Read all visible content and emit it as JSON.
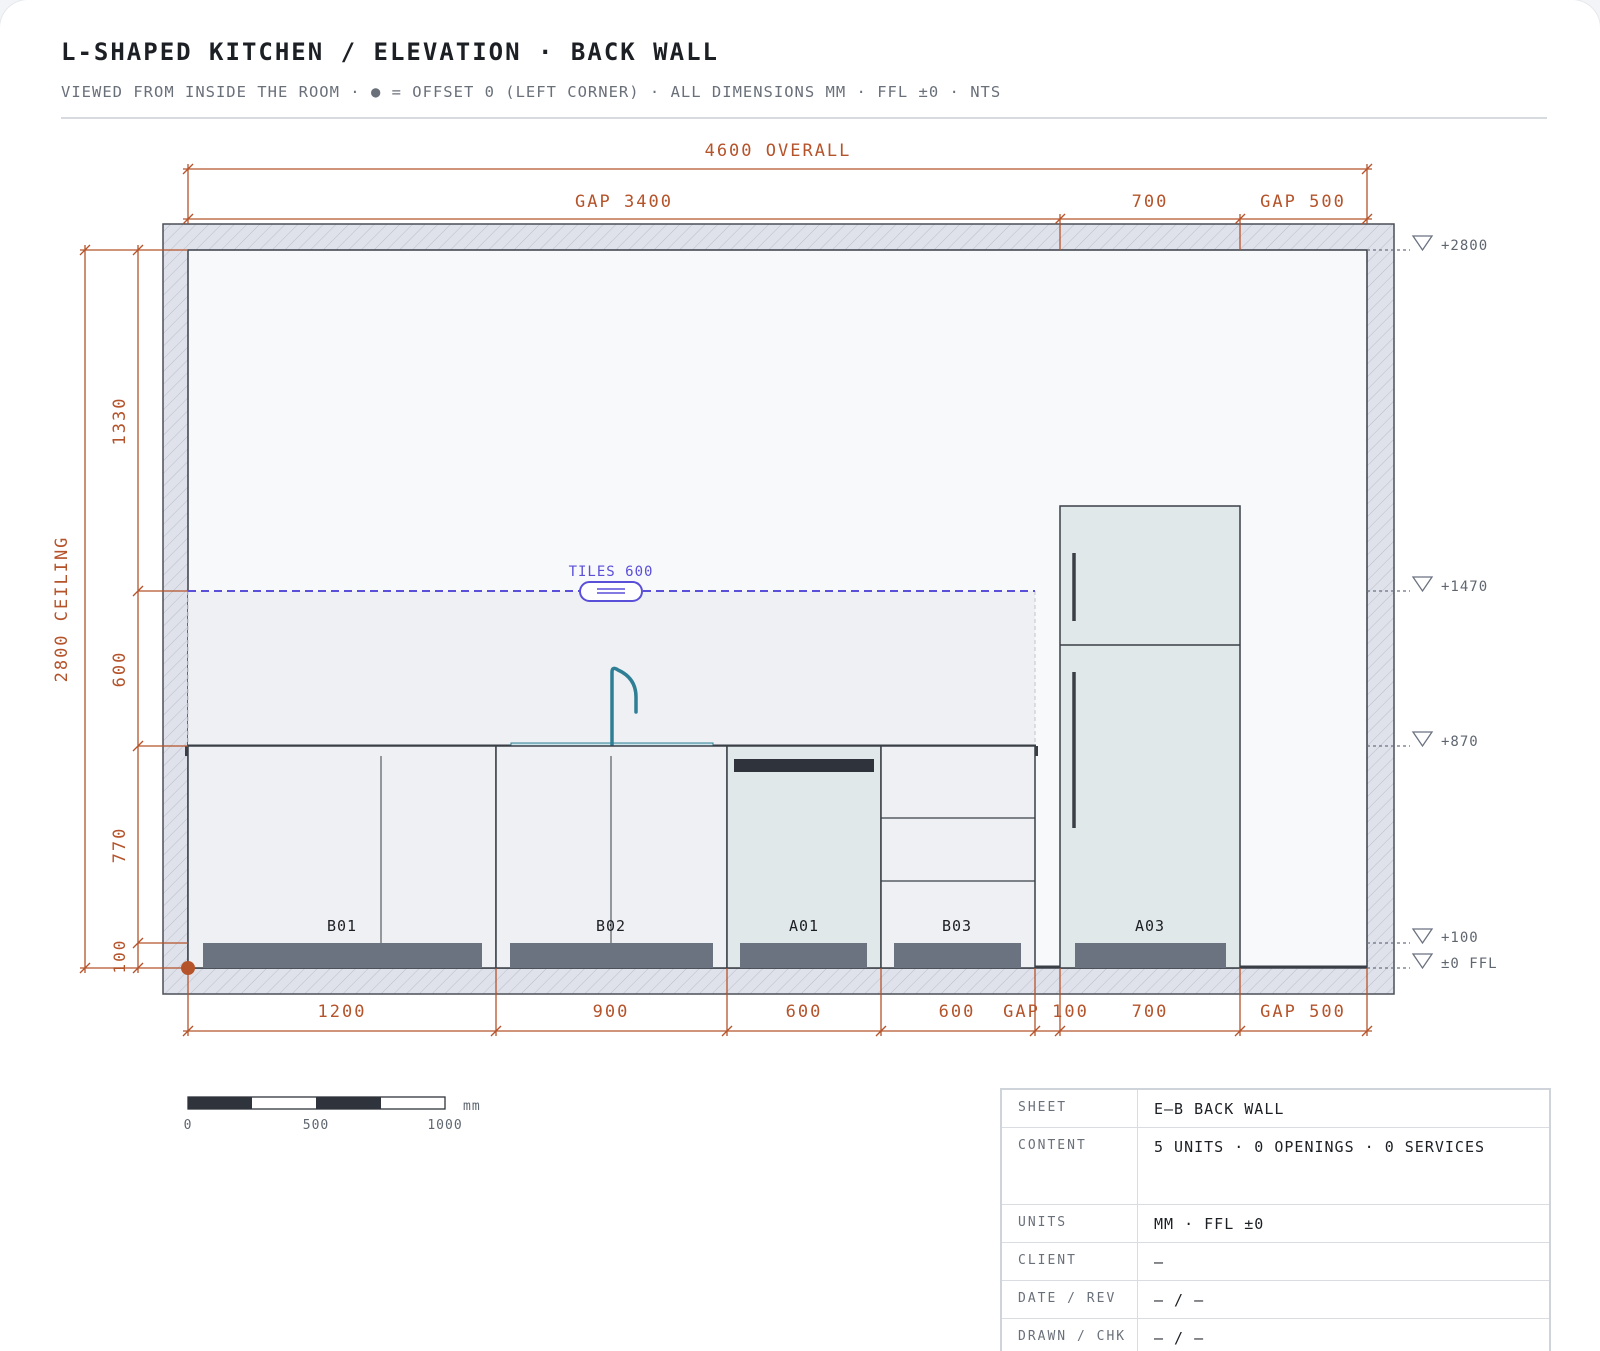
{
  "header": {
    "title": "L-SHAPED KITCHEN / ELEVATION · BACK WALL",
    "subtitle": "VIEWED FROM INSIDE THE ROOM · ● = OFFSET 0 (LEFT CORNER) · ALL DIMENSIONS MM · FFL ±0 · NTS"
  },
  "colors": {
    "dimension": "#b5532a",
    "tile_line": "#5a4fd8",
    "faucet": "#2e7f96",
    "wall_hatch": "#dfe2ea",
    "unit_fill": "#eef0f3",
    "appliance_fill": "#e1e8ea",
    "plinth": "#6b7280"
  },
  "elevation": {
    "top_dimensions": {
      "overall": "4600 OVERALL",
      "segments": [
        "GAP 3400",
        "700",
        "GAP 500"
      ]
    },
    "bottom_dimensions": [
      "1200",
      "900",
      "600",
      "600",
      "GAP 100",
      "700",
      "GAP 500"
    ],
    "left_dimensions": {
      "ceiling": "2800 CEILING",
      "segments": [
        "1330",
        "600",
        "770",
        "100"
      ]
    },
    "levels": [
      "+2800",
      "+1470",
      "+870",
      "+100",
      "±0 FFL"
    ],
    "tiles_label": "TILES 600",
    "units": [
      {
        "id": "B01",
        "type": "base cabinet, 2 doors"
      },
      {
        "id": "B02",
        "type": "sink base, 2 doors"
      },
      {
        "id": "A01",
        "type": "dishwasher"
      },
      {
        "id": "B03",
        "type": "drawer base, 3 drawers"
      },
      {
        "id": "A03",
        "type": "fridge-freezer"
      }
    ],
    "offset_marker_icon": "origin-dot-icon",
    "level_marker_icon": "level-triangle-icon"
  },
  "scale_bar": {
    "unit": "mm",
    "labels": [
      "0",
      "500",
      "1000"
    ]
  },
  "title_block": [
    {
      "key": "SHEET",
      "value": "E—B BACK WALL"
    },
    {
      "key": "CONTENT",
      "value": "5 UNITS · 0 OPENINGS · 0 SERVICES"
    },
    {
      "key": "UNITS",
      "value": "MM · FFL ±0"
    },
    {
      "key": "CLIENT",
      "value": "—"
    },
    {
      "key": "DATE / REV",
      "value": "— / —"
    },
    {
      "key": "DRAWN / CHK",
      "value": "— / —"
    }
  ]
}
